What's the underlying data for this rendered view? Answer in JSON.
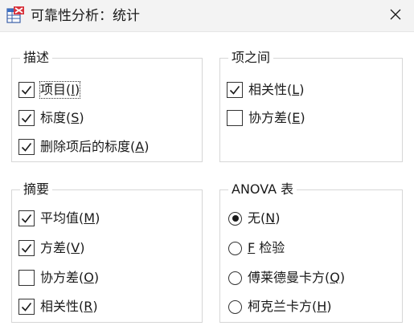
{
  "window": {
    "title": "可靠性分析：统计",
    "app_icon": "spss-table-icon",
    "close_icon": "close-icon"
  },
  "groups": {
    "descriptives": {
      "title": "描述",
      "items": [
        {
          "text": "项目",
          "mnemonic": "I",
          "checked": true
        },
        {
          "text": "标度",
          "mnemonic": "S",
          "checked": true
        },
        {
          "text": "删除项后的标度",
          "mnemonic": "A",
          "checked": true
        }
      ]
    },
    "inter_item": {
      "title": "项之间",
      "items": [
        {
          "text": "相关性",
          "mnemonic": "L",
          "checked": true
        },
        {
          "text": "协方差",
          "mnemonic": "E",
          "checked": false
        }
      ]
    },
    "summaries": {
      "title": "摘要",
      "items": [
        {
          "text": "平均值",
          "mnemonic": "M",
          "checked": true
        },
        {
          "text": "方差",
          "mnemonic": "V",
          "checked": true
        },
        {
          "text": "协方差",
          "mnemonic": "O",
          "checked": false
        },
        {
          "text": "相关性",
          "mnemonic": "R",
          "checked": true
        }
      ]
    },
    "anova": {
      "title": "ANOVA 表",
      "options": [
        {
          "pre": "无",
          "mnemonic": "N",
          "post": "",
          "selected": true,
          "mn_style": "paren"
        },
        {
          "pre": "",
          "mnemonic": "F",
          "post": " 检验",
          "selected": false,
          "mn_style": "plain"
        },
        {
          "pre": "傅莱德曼卡方",
          "mnemonic": "Q",
          "post": "",
          "selected": false,
          "mn_style": "paren"
        },
        {
          "pre": "柯克兰卡方",
          "mnemonic": "H",
          "post": "",
          "selected": false,
          "mn_style": "paren"
        }
      ]
    }
  },
  "colors": {
    "titlebar_bg": "#f3f3f3",
    "group_border": "#d6d6d6",
    "text": "#1a1a1a"
  }
}
